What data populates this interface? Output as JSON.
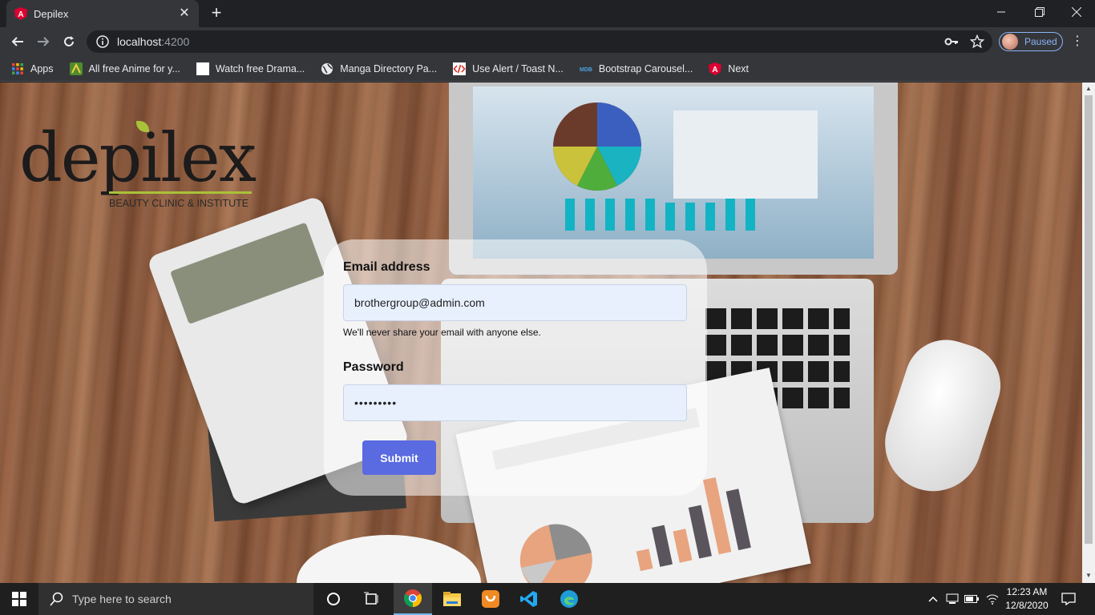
{
  "browser": {
    "tab_title": "Depilex",
    "url_host": "localhost",
    "url_port": ":4200",
    "profile_label": "Paused",
    "bookmarks": [
      {
        "label": "Apps",
        "icon": "apps-grid-icon"
      },
      {
        "label": "All free Anime for y...",
        "icon": "anime-site-icon"
      },
      {
        "label": "Watch free Drama...",
        "icon": "blank-page-icon"
      },
      {
        "label": "Manga Directory Pa...",
        "icon": "globe-icon"
      },
      {
        "label": "Use Alert / Toast N...",
        "icon": "code-icon"
      },
      {
        "label": "Bootstrap Carousel...",
        "icon": "mdb-icon"
      },
      {
        "label": "Next",
        "icon": "angular-icon"
      }
    ]
  },
  "logo": {
    "word": "depilex",
    "registered": "®",
    "subtitle": "BEAUTY CLINIC & INSTITUTE"
  },
  "form": {
    "email_label": "Email address",
    "email_value": "brothergroup@admin.com",
    "email_hint": "We'll never share your email with anyone else.",
    "password_label": "Password",
    "password_value": "•••••••••",
    "submit_label": "Submit"
  },
  "taskbar": {
    "search_placeholder": "Type here to search",
    "time": "12:23 AM",
    "date": "12/8/2020"
  },
  "colors": {
    "accent_button": "#5a6ae0",
    "input_bg": "#e8f0fe",
    "logo_green": "#a8c23a",
    "angular_red": "#dd0031"
  }
}
